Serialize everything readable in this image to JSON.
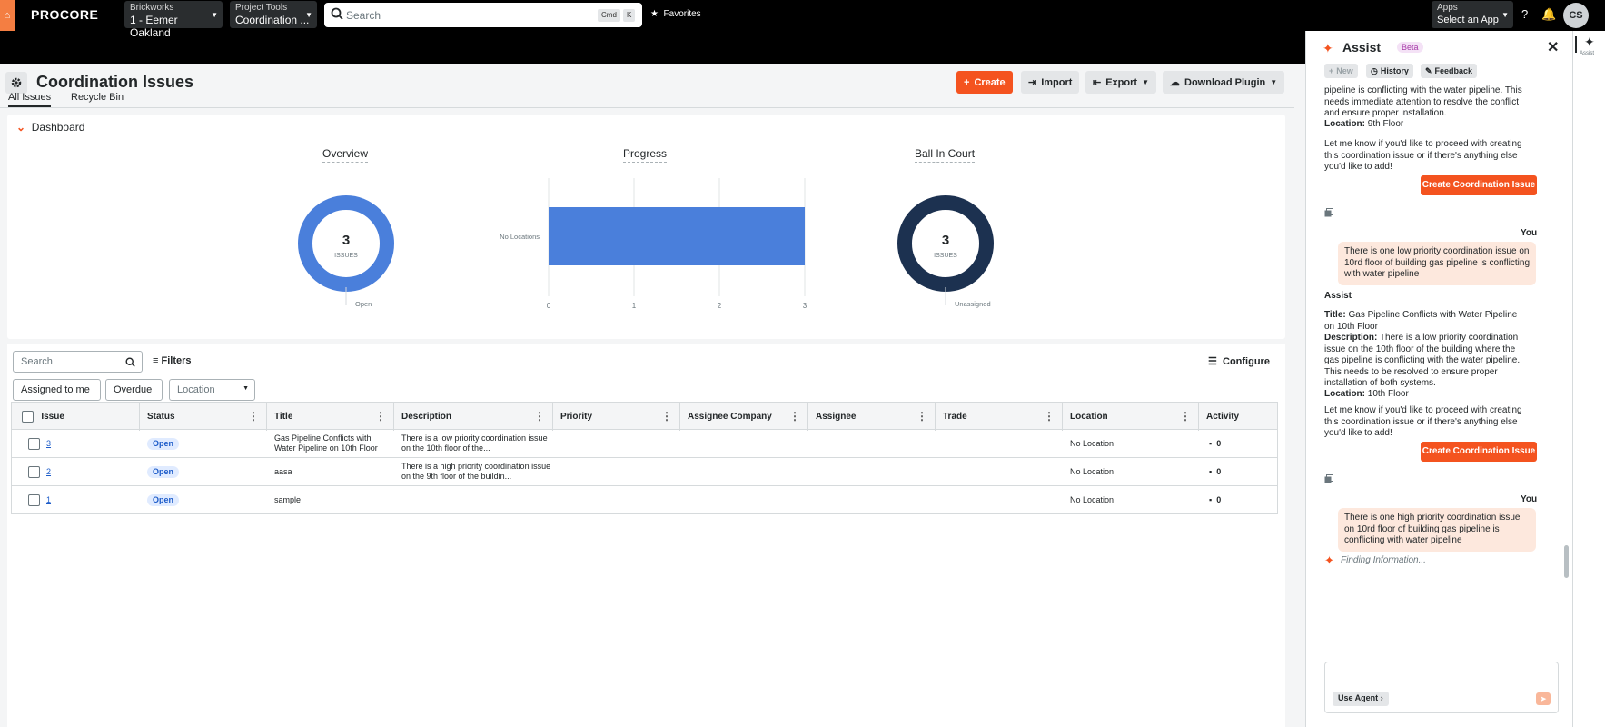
{
  "topbar": {
    "logo": "PROCORE",
    "company": {
      "label": "Brickworks",
      "value": "1 - Eemer Oakland"
    },
    "tool": {
      "label": "Project Tools",
      "value": "Coordination ..."
    },
    "search": {
      "placeholder": "Search",
      "kbd1": "Cmd",
      "kbd2": "K"
    },
    "favorites": "Favorites",
    "apps": {
      "label": "Apps",
      "value": "Select an App"
    },
    "avatar": "CS"
  },
  "page": {
    "title": "Coordination Issues",
    "buttons": {
      "create": "Create",
      "import": "Import",
      "export": "Export",
      "download": "Download Plugin"
    },
    "tabs": [
      "All Issues",
      "Recycle Bin"
    ]
  },
  "dashboard": {
    "header": "Dashboard",
    "overview": {
      "title": "Overview",
      "count": "3",
      "unit": "ISSUES",
      "legend": "Open"
    },
    "progress": {
      "title": "Progress",
      "category": "No Locations",
      "value": 3,
      "ticks": [
        "0",
        "1",
        "2",
        "3"
      ]
    },
    "ball": {
      "title": "Ball In Court",
      "count": "3",
      "unit": "ISSUES",
      "legend": "Unassigned"
    }
  },
  "filters": {
    "search_placeholder": "Search",
    "filters": "Filters",
    "assigned": "Assigned to me",
    "overdue": "Overdue",
    "location": "Location",
    "configure": "Configure"
  },
  "table": {
    "columns": [
      "Issue",
      "Status",
      "Title",
      "Description",
      "Priority",
      "Assignee Company",
      "Assignee",
      "Trade",
      "Location",
      "Activity"
    ],
    "rows": [
      {
        "issue": "3",
        "status": "Open",
        "title": "Gas Pipeline Conflicts with Water Pipeline on 10th Floor",
        "description": "There is a low priority coordination issue on the 10th floor of the...",
        "location": "No Location",
        "activity": "0"
      },
      {
        "issue": "2",
        "status": "Open",
        "title": "aasa",
        "description": "There is a high priority coordination issue on the 9th floor of the buildin...",
        "location": "No Location",
        "activity": "0"
      },
      {
        "issue": "1",
        "status": "Open",
        "title": "sample",
        "description": "",
        "location": "No Location",
        "activity": "0"
      }
    ]
  },
  "assist": {
    "title": "Assist",
    "beta": "Beta",
    "buttons": {
      "new": "New",
      "history": "History",
      "feedback": "Feedback"
    },
    "m1_text": "pipeline is conflicting with the water pipeline. This needs immediate attention to resolve the conflict and ensure proper installation.",
    "m1_loc_label": "Location:",
    "m1_loc": "9th Floor",
    "prompt_text": "Let me know if you'd like to proceed with creating this coordination issue or if there's anything else you'd like to add!",
    "create_btn": "Create Coordination Issue",
    "you": "You",
    "user1": "There is one low priority coordination issue on 10rd floor of building gas pipeline is conflicting with water pipeline",
    "assist_label": "Assist",
    "title_label": "Title:",
    "m2_title": "Gas Pipeline Conflicts with Water Pipeline on 10th Floor",
    "desc_label": "Description:",
    "m2_desc": "There is a low priority coordination issue on the 10th floor of the building where the gas pipeline is conflicting with the water pipeline. This needs to be resolved to ensure proper installation of both systems.",
    "m2_loc": "10th Floor",
    "user2": "There is one high priority coordination issue on 10rd floor of building gas pipeline is conflicting with water pipeline",
    "finding": "Finding Information...",
    "use_agent": "Use Agent",
    "rail_label": "Assist"
  },
  "colors": {
    "accent": "#f4531f",
    "donut_open": "#4a7fdb",
    "donut_ball": "#1c3150",
    "bar": "#4a7fdb"
  }
}
